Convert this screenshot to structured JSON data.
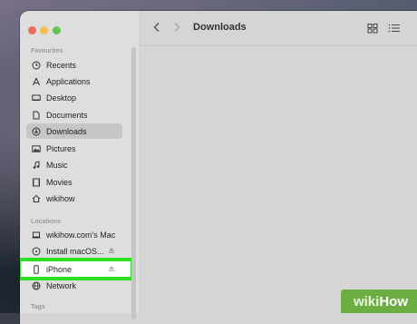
{
  "finder": {
    "title": "Downloads",
    "favourites_label": "Favourites",
    "locations_label": "Locations",
    "tags_label": "Tags",
    "favourites": [
      {
        "label": "Recents",
        "icon": "clock-icon"
      },
      {
        "label": "Applications",
        "icon": "applications-icon"
      },
      {
        "label": "Desktop",
        "icon": "desktop-icon"
      },
      {
        "label": "Documents",
        "icon": "document-icon"
      },
      {
        "label": "Downloads",
        "icon": "download-icon",
        "selected": true
      },
      {
        "label": "Pictures",
        "icon": "picture-icon"
      },
      {
        "label": "Music",
        "icon": "music-icon"
      },
      {
        "label": "Movies",
        "icon": "film-icon"
      },
      {
        "label": "wikihow",
        "icon": "home-icon"
      }
    ],
    "locations": [
      {
        "label": "wikihow.com's Mac",
        "icon": "laptop-icon"
      },
      {
        "label": "Install macOS...",
        "icon": "disk-icon"
      },
      {
        "label": "iPhone",
        "icon": "iphone-icon",
        "highlighted": true
      },
      {
        "label": "Network",
        "icon": "network-icon"
      }
    ]
  },
  "watermark": {
    "part1": "wiki",
    "part2": "How"
  },
  "colors": {
    "highlight": "#2ee024",
    "watermark_bg": "#6cae41"
  }
}
